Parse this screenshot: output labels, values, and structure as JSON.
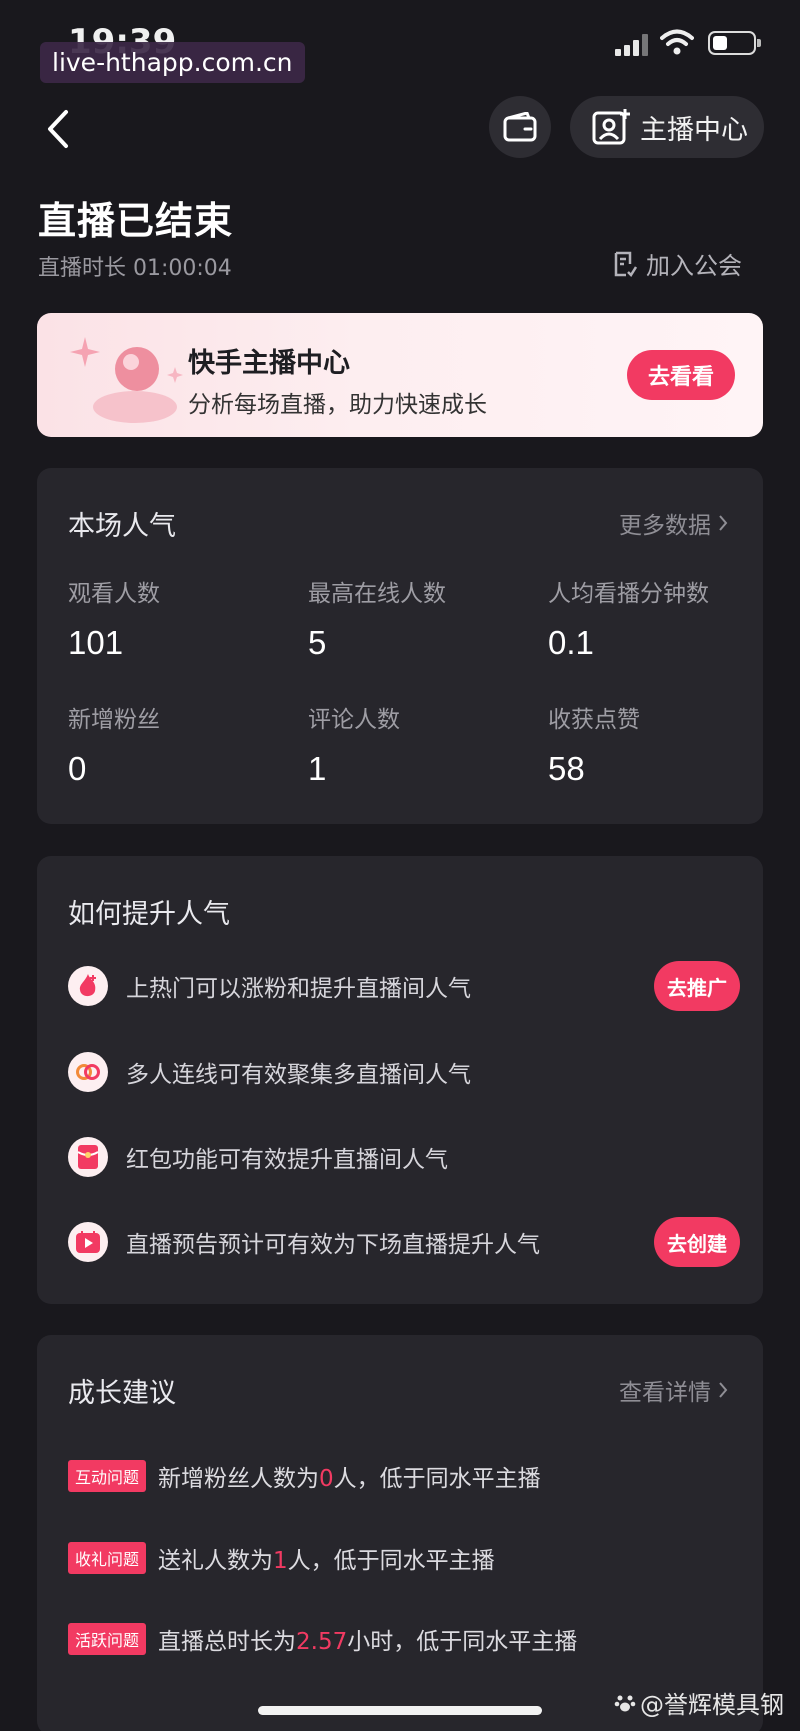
{
  "status_bar": {
    "time": "19:39",
    "url_overlay": "live-hthapp.com.cn"
  },
  "header": {
    "anchor_center_label": "主播中心"
  },
  "page": {
    "title": "直播已结束",
    "duration_label": "直播时长 01:00:04",
    "join_guild": "加入公会"
  },
  "banner": {
    "title": "快手主播中心",
    "subtitle": "分析每场直播，助力快速成长",
    "button": "去看看"
  },
  "popularity": {
    "title": "本场人气",
    "more": "更多数据",
    "stats": [
      {
        "label": "观看人数",
        "value": "101"
      },
      {
        "label": "最高在线人数",
        "value": "5"
      },
      {
        "label": "人均看播分钟数",
        "value": "0.1"
      },
      {
        "label": "新增粉丝",
        "value": "0"
      },
      {
        "label": "评论人数",
        "value": "1"
      },
      {
        "label": "收获点赞",
        "value": "58"
      }
    ]
  },
  "boost": {
    "title": "如何提升人气",
    "tips": [
      {
        "text": "上热门可以涨粉和提升直播间人气",
        "button": "去推广"
      },
      {
        "text": "多人连线可有效聚集多直播间人气",
        "button": ""
      },
      {
        "text": "红包功能可有效提升直播间人气",
        "button": ""
      },
      {
        "text": "直播预告预计可有效为下场直播提升人气",
        "button": "去创建"
      }
    ]
  },
  "growth": {
    "title": "成长建议",
    "more": "查看详情",
    "items": [
      {
        "tag": "互动问题",
        "prefix": "新增粉丝人数为",
        "value": "0",
        "suffix": "人，低于同水平主播"
      },
      {
        "tag": "收礼问题",
        "prefix": "送礼人数为",
        "value": "1",
        "suffix": "人，低于同水平主播"
      },
      {
        "tag": "活跃问题",
        "prefix": "直播总时长为",
        "value": "2.57",
        "suffix": "小时，低于同水平主播"
      }
    ]
  },
  "footer": {
    "watermark": "@誉辉模具钢"
  },
  "colors": {
    "accent": "#f23a62",
    "background": "#19181d",
    "card": "#27262c"
  },
  "icons": [
    "back-arrow-icon",
    "wallet-icon",
    "anchor-profile-icon",
    "join-guild-icon",
    "fire-icon",
    "link-icon",
    "red-packet-icon",
    "preview-play-icon",
    "chevron-right-icon"
  ]
}
